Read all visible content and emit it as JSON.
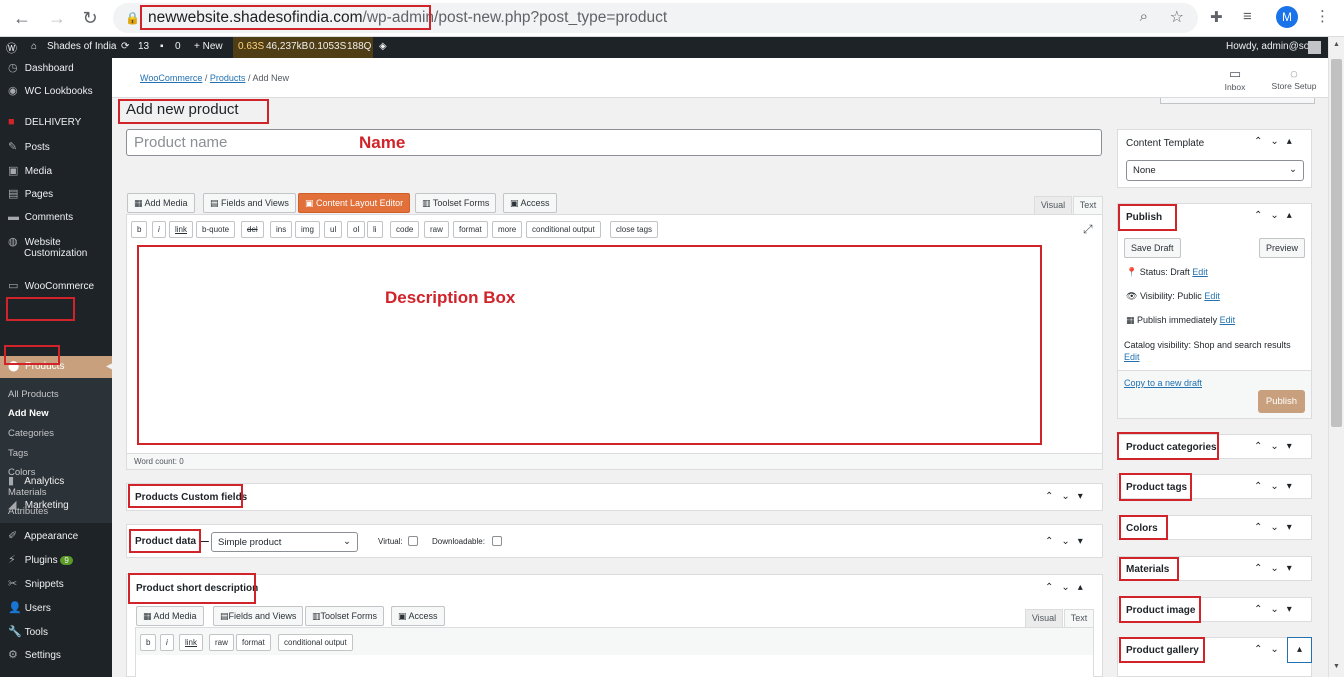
{
  "browser": {
    "url_host": "newwebsite.shadesofindia.com",
    "url_path": "/wp-admin/post-new.php?post_type=product",
    "avatar": "M"
  },
  "adminbar": {
    "site": "Shades of India",
    "updates": "13",
    "comments": "0",
    "new": "+ New",
    "qm1": "0.63S",
    "qm2": "46,237kB",
    "qm3": "0.1053S",
    "qm4": "188Q",
    "howdy": "Howdy, admin@soi"
  },
  "sidebar": {
    "items": [
      "Dashboard",
      "WC Lookbooks",
      "DELHIVERY",
      "Posts",
      "Media",
      "Pages",
      "Comments",
      "Website",
      "Customization",
      "WooCommerce",
      "Products"
    ],
    "sub": [
      "All Products",
      "Add New",
      "Categories",
      "Tags",
      "Colors",
      "Materials",
      "Attributes"
    ],
    "items2": [
      "Analytics",
      "Marketing",
      "Appearance",
      "Plugins",
      "Snippets",
      "Users",
      "Tools",
      "Settings"
    ],
    "plugins_badge": "9"
  },
  "header": {
    "crumb1": "WooCommerce",
    "sep": "/",
    "crumb2": "Products",
    "crumb3": "Add New",
    "inbox": "Inbox",
    "store": "Store Setup"
  },
  "page": {
    "title": "Add new product",
    "name_placeholder": "Product name",
    "name_annotation": "Name",
    "desc_annotation": "Description Box",
    "word_count": "Word count: 0"
  },
  "editor": {
    "add_media": "Add Media",
    "fields_views": "Fields and Views",
    "content_layout": "Content Layout Editor",
    "toolset_forms": "Toolset Forms",
    "access": "Access",
    "visual": "Visual",
    "text": "Text",
    "quicktags": [
      "b",
      "i",
      "link",
      "b-quote",
      "del",
      "ins",
      "img",
      "ul",
      "ol",
      "li",
      "code",
      "raw",
      "format",
      "more",
      "conditional output",
      "close tags"
    ]
  },
  "panels": {
    "custom_fields": "Products Custom fields",
    "product_data": "Product data —",
    "product_type": "Simple product",
    "virtual": "Virtual:",
    "downloadable": "Downloadable:",
    "short_desc": "Product short description",
    "short_quicktags": [
      "b",
      "i",
      "link",
      "raw",
      "format",
      "conditional output"
    ]
  },
  "right": {
    "content_template": "Content Template",
    "ct_value": "None",
    "publish": "Publish",
    "save_draft": "Save Draft",
    "preview": "Preview",
    "status": "Status: Draft",
    "visibility": "Visibility: Public",
    "publish_immediately": "Publish immediately",
    "catalog": "Catalog visibility: Shop and search results",
    "edit": "Edit",
    "copy_draft": "Copy to a new draft",
    "publish_btn": "Publish",
    "categories": "Product categories",
    "tags": "Product tags",
    "colors": "Colors",
    "materials": "Materials",
    "image": "Product image",
    "gallery": "Product gallery"
  },
  "colors": {
    "accent": "#d0232a",
    "wp_dark": "#1d2327",
    "woo": "#c9a07e",
    "orange": "#e2703a"
  }
}
